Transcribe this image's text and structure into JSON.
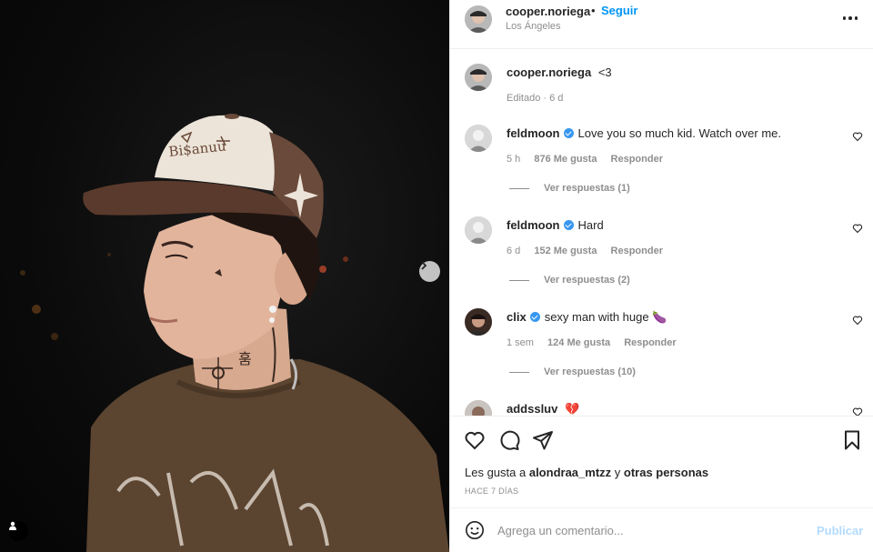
{
  "post": {
    "photo_alt": "Photo of a young man in a brown and white trucker cap",
    "next_icon": "chevron-right-icon",
    "tag_icon": "user-tag-icon"
  },
  "header": {
    "username": "cooper.noriega",
    "separator": "•",
    "follow_label": "Seguir",
    "location": "Los Ángeles",
    "more_icon": "more-options-icon"
  },
  "caption": {
    "username": "cooper.noriega",
    "text": "<3",
    "meta": "Editado · 6 d"
  },
  "comments": [
    {
      "username": "feldmoon",
      "verified": true,
      "text": "Love you so much kid. Watch over me.",
      "time": "5 h",
      "likes": "876 Me gusta",
      "reply_label": "Responder",
      "replies": "Ver respuestas (1)"
    },
    {
      "username": "feldmoon",
      "verified": true,
      "text": "Hard",
      "time": "6 d",
      "likes": "152 Me gusta",
      "reply_label": "Responder",
      "replies": "Ver respuestas (2)"
    },
    {
      "username": "clix",
      "verified": true,
      "text": "sexy man with huge 🍆",
      "time": "1 sem",
      "likes": "124 Me gusta",
      "reply_label": "Responder",
      "replies": "Ver respuestas (10)"
    },
    {
      "username": "addssluv",
      "verified": false,
      "text": "💔"
    }
  ],
  "actions": {
    "like_icon": "heart-icon",
    "comment_icon": "comment-icon",
    "share_icon": "share-icon",
    "save_icon": "bookmark-icon"
  },
  "likes": {
    "prefix": "Les gusta a",
    "user": "alondraa_mtzz",
    "joiner": "y",
    "others": "otras personas"
  },
  "time_ago": "HACE 7 DÍAS",
  "add_comment": {
    "placeholder": "Agrega un comentario...",
    "publish_label": "Publicar",
    "emoji_icon": "emoji-icon"
  },
  "colors": {
    "accent": "#0095f6",
    "publish_disabled": "#b3dbff",
    "verified": "#3897f0",
    "muted": "#8e8e8e",
    "text": "#262626"
  }
}
